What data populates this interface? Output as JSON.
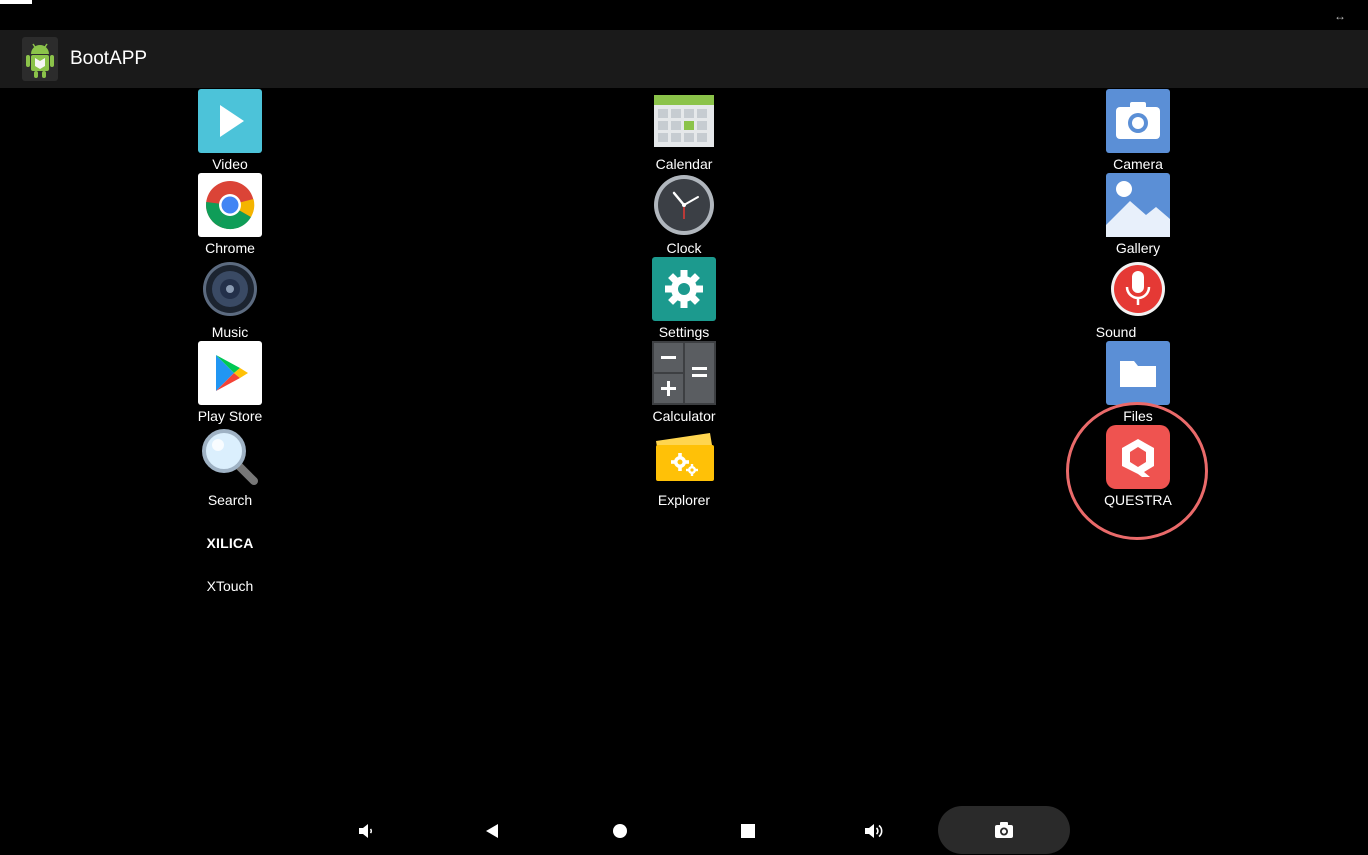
{
  "window": {
    "title": "BootAPP"
  },
  "apps": {
    "video": "Video",
    "chrome": "Chrome",
    "music": "Music",
    "play_store": "Play Store",
    "search": "Search",
    "xtouch": "XTouch",
    "xtouch_logo": "XILICA",
    "calendar": "Calendar",
    "clock": "Clock",
    "settings": "Settings",
    "calculator": "Calculator",
    "explorer": "Explorer",
    "camera": "Camera",
    "gallery": "Gallery",
    "sound": "Sound",
    "files": "Files",
    "questra": "QUESTRA"
  },
  "highlight_color": "#ea6a6a",
  "navbar": {
    "icons": [
      "volume-down-icon",
      "back-icon",
      "home-icon",
      "recents-icon",
      "volume-up-icon",
      "screenshot-icon"
    ]
  }
}
